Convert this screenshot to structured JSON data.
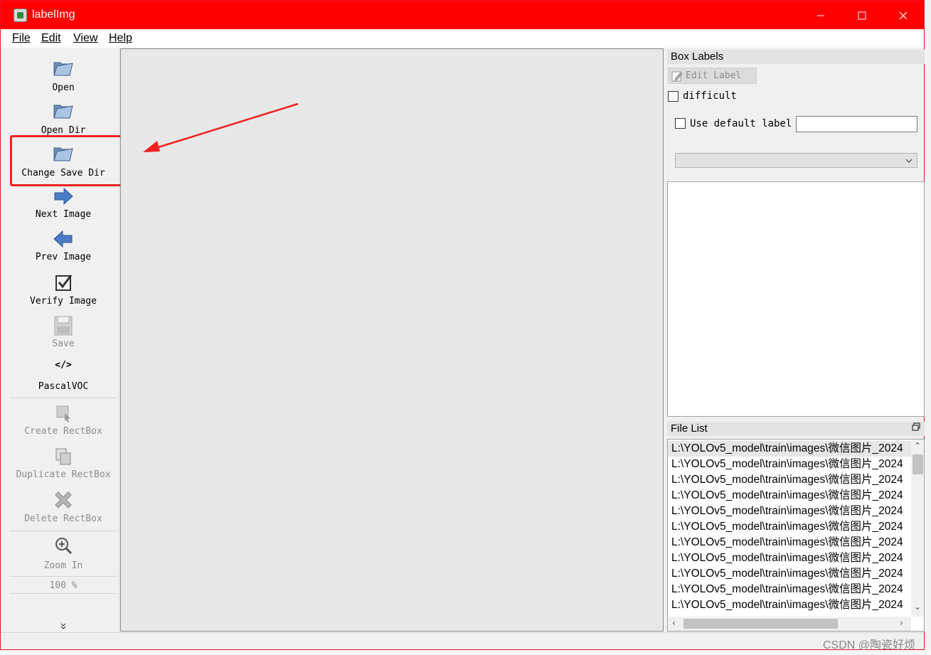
{
  "window": {
    "title": "labelImg"
  },
  "menu": [
    "File",
    "Edit",
    "View",
    "Help"
  ],
  "toolbar": {
    "open": "Open",
    "open_dir": "Open Dir",
    "change_save_dir": "Change Save Dir",
    "next_image": "Next Image",
    "prev_image": "Prev Image",
    "verify_image": "Verify Image",
    "save": "Save",
    "format_icon_text": "</>",
    "format": "PascalVOC",
    "create_rectbox": "Create RectBox",
    "duplicate_rectbox": "Duplicate RectBox",
    "delete_rectbox": "Delete RectBox",
    "zoom_in": "Zoom In",
    "zoom_level": "100 %",
    "more_icon": "chevron-double-down-icon"
  },
  "box_labels": {
    "title": "Box Labels",
    "edit_label": "Edit Label",
    "difficult": "difficult",
    "use_default_label": "Use default label",
    "default_label_value": "",
    "combo_value": ""
  },
  "file_list": {
    "title": "File List",
    "files": [
      "L:\\YOLOv5_model\\train\\images\\微信图片_2024",
      "L:\\YOLOv5_model\\train\\images\\微信图片_2024",
      "L:\\YOLOv5_model\\train\\images\\微信图片_2024",
      "L:\\YOLOv5_model\\train\\images\\微信图片_2024",
      "L:\\YOLOv5_model\\train\\images\\微信图片_2024",
      "L:\\YOLOv5_model\\train\\images\\微信图片_2024",
      "L:\\YOLOv5_model\\train\\images\\微信图片_2024",
      "L:\\YOLOv5_model\\train\\images\\微信图片_2024",
      "L:\\YOLOv5_model\\train\\images\\微信图片_2024",
      "L:\\YOLOv5_model\\train\\images\\微信图片_2024",
      "L:\\YOLOv5_model\\train\\images\\微信图片_2024"
    ]
  },
  "watermark": "CSDN @陶瓷好烦",
  "colors": {
    "titlebar": "#ff0000",
    "highlight": "#f32020",
    "canvas": "#e8e8e8"
  }
}
